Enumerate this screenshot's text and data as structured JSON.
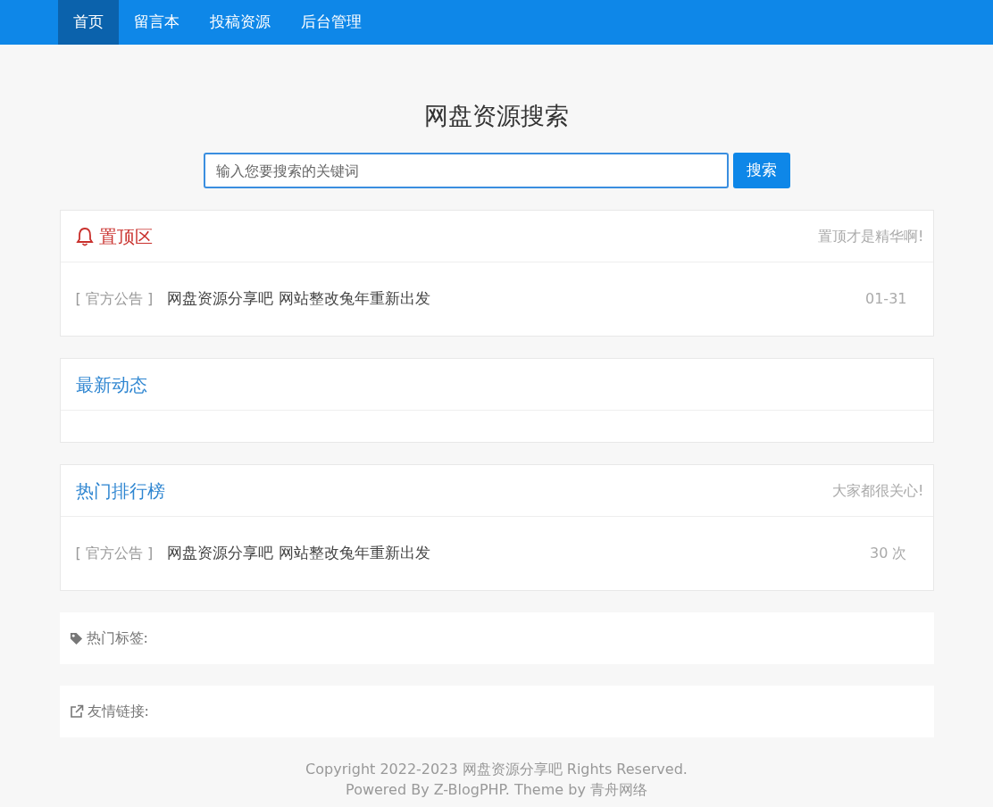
{
  "nav": [
    {
      "label": "首页",
      "selected": true
    },
    {
      "label": "留言本",
      "selected": false
    },
    {
      "label": "投稿资源",
      "selected": false
    },
    {
      "label": "后台管理",
      "selected": false
    }
  ],
  "heading": "网盘资源搜索",
  "search": {
    "placeholder": "输入您要搜索的关键词",
    "button": "搜索"
  },
  "panels": [
    {
      "kind": "pinned",
      "title": "置顶区",
      "subtitle": "置顶才是精华啊!",
      "items": [
        {
          "tag": "[ 官方公告 ]",
          "title": "网盘资源分享吧 网站整改兔年重新出发",
          "meta": "01-31"
        }
      ]
    },
    {
      "kind": "normal",
      "title": "最新动态"
    },
    {
      "kind": "normal",
      "title": "热门排行榜",
      "subtitle": "大家都很关心!",
      "items": [
        {
          "tag": "[ 官方公告 ]",
          "title": "网盘资源分享吧 网站整改兔年重新出发",
          "meta": "30 次"
        }
      ]
    }
  ],
  "boxes": [
    {
      "kind": "tags",
      "label": "热门标签:"
    },
    {
      "kind": "links",
      "label": "友情链接:"
    }
  ],
  "footer": [
    "Copyright 2022-2023 网盘资源分享吧 Rights Reserved.",
    "Powered By Z-BlogPHP. Theme by 青舟网络"
  ]
}
